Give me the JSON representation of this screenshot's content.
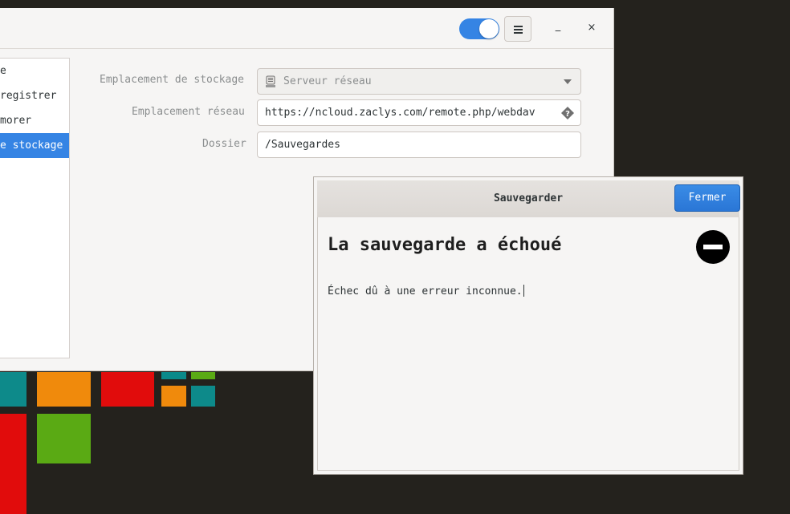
{
  "main_window": {
    "sidebar": {
      "items": [
        {
          "label": "e",
          "selected": false
        },
        {
          "label": "registrer",
          "selected": false
        },
        {
          "label": "morer",
          "selected": false
        },
        {
          "label": "e stockage",
          "selected": true
        }
      ]
    },
    "form": {
      "storage_label": "Emplacement de stockage",
      "storage_value": "Serveur réseau",
      "network_label": "Emplacement réseau",
      "network_value": "https://ncloud.zaclys.com/remote.php/webdav",
      "folder_label": "Dossier",
      "folder_value": "/Sauvegardes"
    },
    "header": {
      "toggle_on": true,
      "minimize_symbol": "_",
      "close_symbol": "×"
    }
  },
  "dialog": {
    "title": "Sauvegarder",
    "close_button": "Fermer",
    "error_title": "La sauvegarde a échoué",
    "error_message": "Échec dû à une erreur inconnue."
  },
  "colors": {
    "accent": "#3584e4",
    "desktop": "#24221d"
  }
}
